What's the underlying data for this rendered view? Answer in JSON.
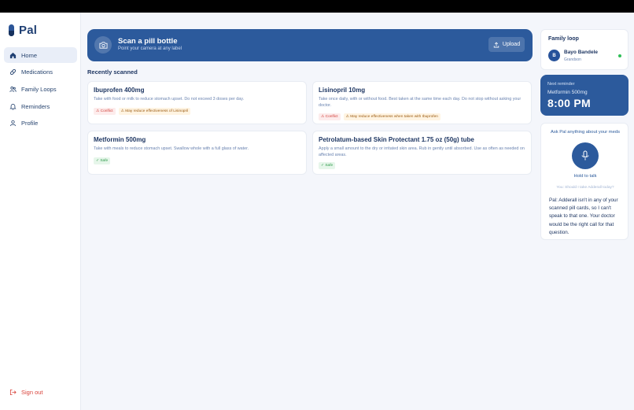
{
  "app": {
    "name": "Pal"
  },
  "sidebar": {
    "items": [
      {
        "label": "Home",
        "icon": "home-icon",
        "active": true
      },
      {
        "label": "Medications",
        "icon": "pill-icon",
        "active": false
      },
      {
        "label": "Family Loops",
        "icon": "users-icon",
        "active": false
      },
      {
        "label": "Reminders",
        "icon": "bell-icon",
        "active": false
      },
      {
        "label": "Profile",
        "icon": "user-icon",
        "active": false
      }
    ],
    "signout_label": "Sign out"
  },
  "scan": {
    "title": "Scan a pill bottle",
    "subtitle": "Point your camera at any label",
    "upload_label": "Upload"
  },
  "recent": {
    "heading": "Recently scanned",
    "cards": [
      {
        "title": "Ibuprofen 400mg",
        "description": "Take with food or milk to reduce stomach upset. Do not exceed 3 doses per day.",
        "tags": [
          {
            "type": "conflict",
            "text": "⚠ Conflict"
          },
          {
            "type": "warn",
            "text": "⚠ May reduce effectiveness of Lisinopril"
          }
        ]
      },
      {
        "title": "Lisinopril 10mg",
        "description": "Take once daily, with or without food. Best taken at the same time each day. Do not stop without asking your doctor.",
        "tags": [
          {
            "type": "conflict",
            "text": "⚠ Conflict"
          },
          {
            "type": "warn",
            "text": "⚠ May reduce effectiveness when taken with Ibuprofen"
          }
        ]
      },
      {
        "title": "Metformin 500mg",
        "description": "Take with meals to reduce stomach upset. Swallow whole with a full glass of water.",
        "tags": [
          {
            "type": "safe",
            "text": "✓ Safe"
          }
        ]
      },
      {
        "title": "Petrolatum-based Skin Protectant 1.75 oz (50g) tube",
        "description": "Apply a small amount to the dry or irritated skin area. Rub in gently until absorbed. Use as often as needed on affected areas.",
        "tags": [
          {
            "type": "safe",
            "text": "✓ Safe"
          }
        ]
      }
    ]
  },
  "family_loop": {
    "title": "Family loop",
    "member": {
      "initial": "B",
      "name": "Bayo Bandele",
      "role": "Grandson",
      "status": "online"
    }
  },
  "next_reminder": {
    "label": "Next reminder",
    "medication": "Metformin 500mg",
    "time": "8:00 PM"
  },
  "assistant": {
    "title": "Ask Pal anything about your meds",
    "hold_label": "Hold to talk",
    "user_question": "You: Should I take Adderall today?",
    "reply": "Pal: Adderall isn't in any of your scanned pill cards, so I can't speak to that one. Your doctor would be the right call for that question."
  },
  "colors": {
    "primary": "#2c5a9c",
    "conflict": "#d2403a",
    "warning": "#9a5a10",
    "safe": "#2e9a4a",
    "online": "#2fbf57"
  }
}
